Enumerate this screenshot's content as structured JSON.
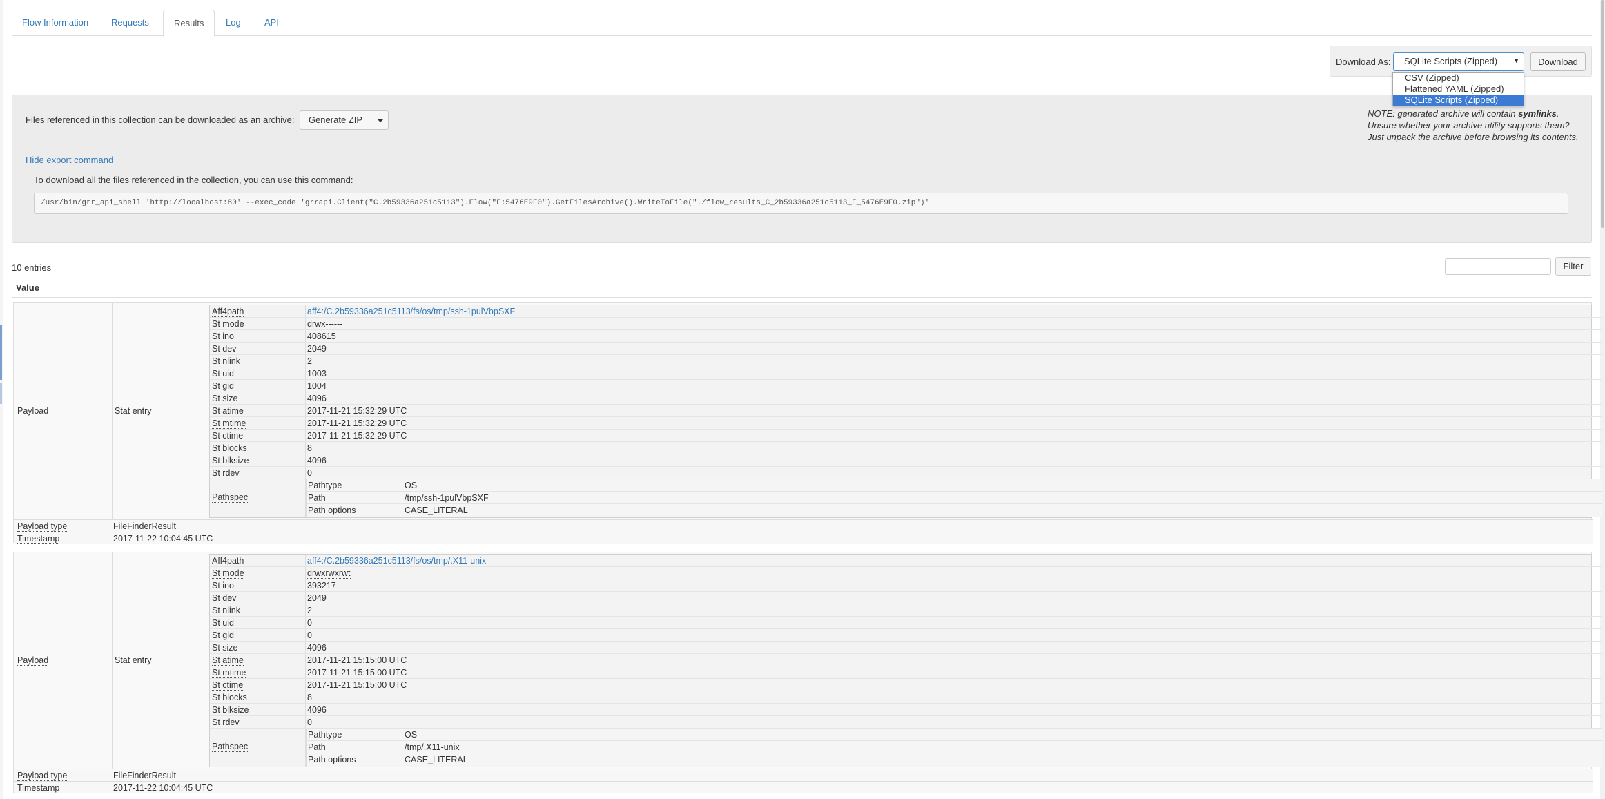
{
  "tabs": [
    {
      "label": "Flow Information"
    },
    {
      "label": "Requests"
    },
    {
      "label": "Results"
    },
    {
      "label": "Log"
    },
    {
      "label": "API"
    }
  ],
  "download": {
    "label": "Download As:",
    "selected": "SQLite Scripts (Zipped)",
    "button": "Download",
    "options": [
      "CSV (Zipped)",
      "Flattened YAML (Zipped)",
      "SQLite Scripts (Zipped)"
    ]
  },
  "export": {
    "archive_text": "Files referenced in this collection can be downloaded as an archive:",
    "zip_button": "Generate ZIP",
    "note_prefix": "NOTE: generated archive will contain ",
    "note_bold": "symlinks",
    "note_suffix": ".",
    "note_line2": "Unsure whether your archive utility supports them?",
    "note_line3": "Just unpack the archive before browsing its contents.",
    "hide_link": "Hide export command",
    "command_label": "To download all the files referenced in the collection, you can use this command:",
    "command": "/usr/bin/grr_api_shell 'http://localhost:80' --exec_code 'grrapi.Client(\"C.2b59336a251c5113\").Flow(\"F:5476E9F0\").GetFilesArchive().WriteToFile(\"./flow_results_C_2b59336a251c5113_F_5476E9F0.zip\")'"
  },
  "results_header": {
    "entries": "10 entries",
    "filter_button": "Filter",
    "column": "Value"
  },
  "labels": {
    "payload": "Payload",
    "stat_entry": "Stat entry",
    "aff4path": "Aff4path",
    "st_mode": "St mode",
    "st_ino": "St ino",
    "st_dev": "St dev",
    "st_nlink": "St nlink",
    "st_uid": "St uid",
    "st_gid": "St gid",
    "st_size": "St size",
    "st_atime": "St atime",
    "st_mtime": "St mtime",
    "st_ctime": "St ctime",
    "st_blocks": "St blocks",
    "st_blksize": "St blksize",
    "st_rdev": "St rdev",
    "pathspec": "Pathspec",
    "pathtype": "Pathtype",
    "path": "Path",
    "path_options": "Path options",
    "payload_type": "Payload type",
    "timestamp": "Timestamp"
  },
  "results": [
    {
      "aff4path": "aff4:/C.2b59336a251c5113/fs/os/tmp/ssh-1pulVbpSXF",
      "st_mode": "drwx------",
      "st_ino": "408615",
      "st_dev": "2049",
      "st_nlink": "2",
      "st_uid": "1003",
      "st_gid": "1004",
      "st_size": "4096",
      "st_atime": "2017-11-21 15:32:29 UTC",
      "st_mtime": "2017-11-21 15:32:29 UTC",
      "st_ctime": "2017-11-21 15:32:29 UTC",
      "st_blocks": "8",
      "st_blksize": "4096",
      "st_rdev": "0",
      "pathtype": "OS",
      "path": "/tmp/ssh-1pulVbpSXF",
      "path_options": "CASE_LITERAL",
      "payload_type": "FileFinderResult",
      "timestamp": "2017-11-22 10:04:45 UTC"
    },
    {
      "aff4path": "aff4:/C.2b59336a251c5113/fs/os/tmp/.X11-unix",
      "st_mode": "drwxrwxrwt",
      "st_ino": "393217",
      "st_dev": "2049",
      "st_nlink": "2",
      "st_uid": "0",
      "st_gid": "0",
      "st_size": "4096",
      "st_atime": "2017-11-21 15:15:00 UTC",
      "st_mtime": "2017-11-21 15:15:00 UTC",
      "st_ctime": "2017-11-21 15:15:00 UTC",
      "st_blocks": "8",
      "st_blksize": "4096",
      "st_rdev": "0",
      "pathtype": "OS",
      "path": "/tmp/.X11-unix",
      "path_options": "CASE_LITERAL",
      "payload_type": "FileFinderResult",
      "timestamp": "2017-11-22 10:04:45 UTC"
    }
  ]
}
